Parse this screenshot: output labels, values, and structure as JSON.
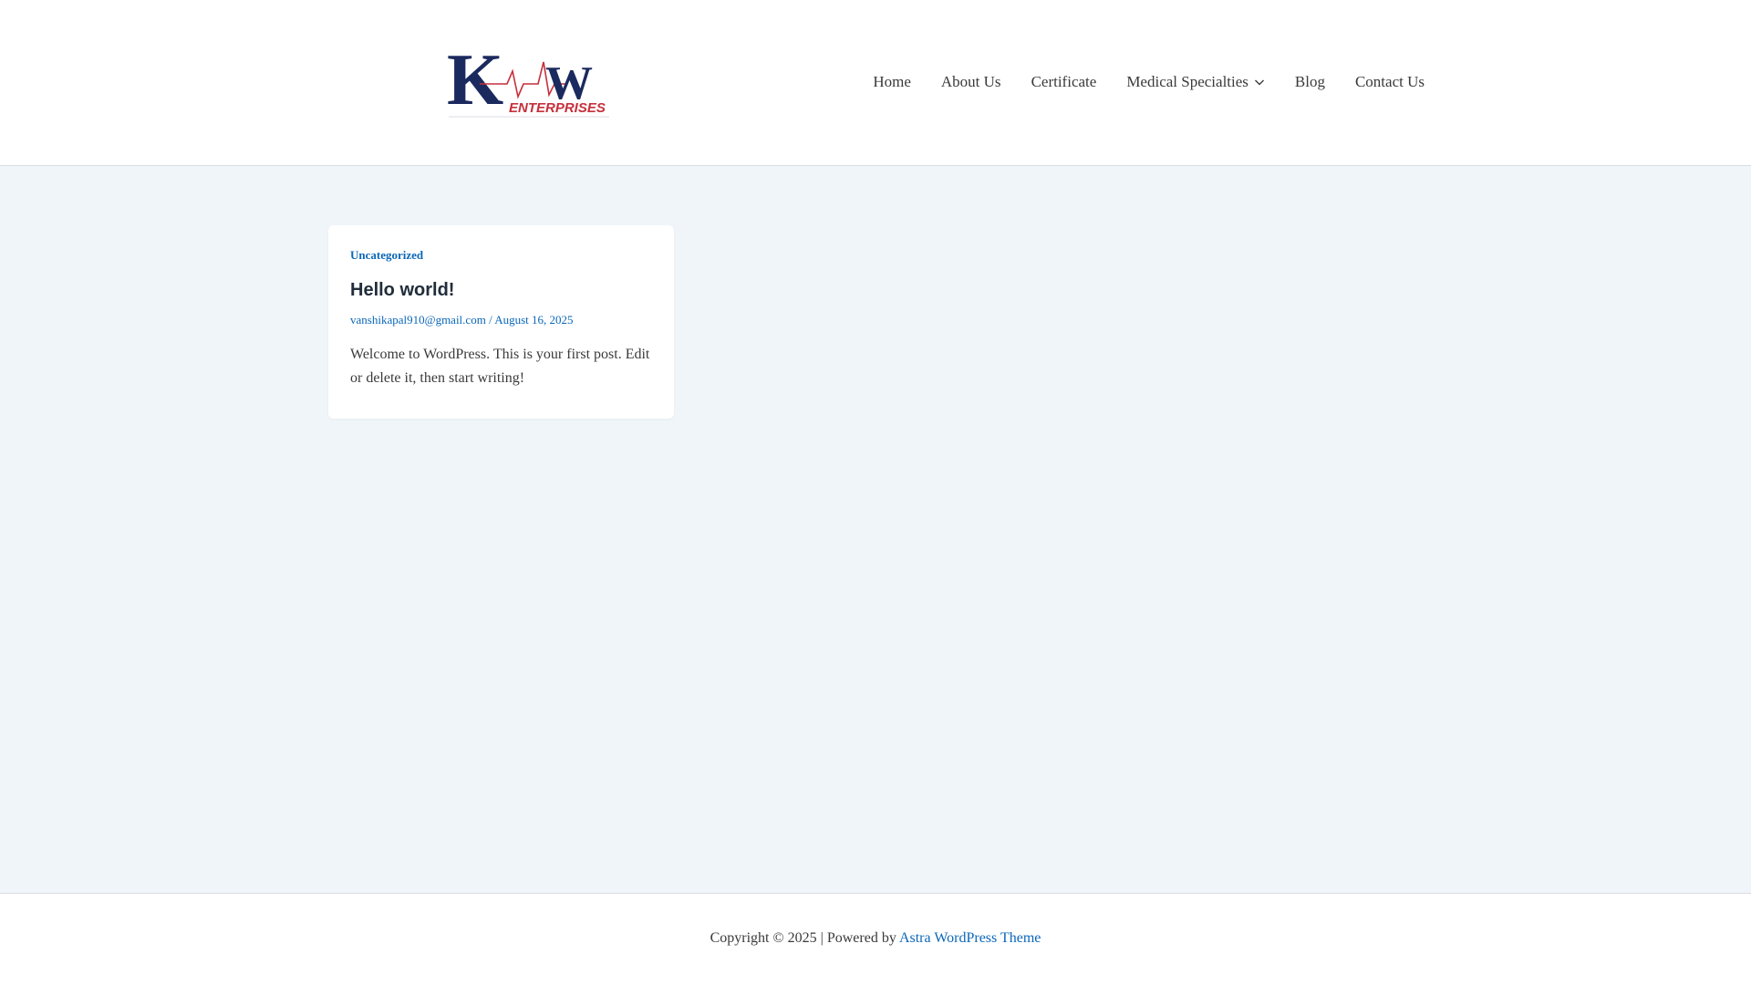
{
  "brand": {
    "logo_letters": "KW",
    "logo_subtitle": "ENTERPRISES",
    "colors": {
      "navy": "#1b2a5e",
      "red": "#c62f3b"
    }
  },
  "nav": {
    "items": [
      {
        "label": "Home"
      },
      {
        "label": "About Us"
      },
      {
        "label": "Certificate"
      },
      {
        "label": "Medical Specialties",
        "has_dropdown": true
      },
      {
        "label": "Blog"
      },
      {
        "label": "Contact Us"
      }
    ]
  },
  "post": {
    "category": "Uncategorized",
    "title": "Hello world!",
    "author": "vanshikapal910@gmail.com",
    "separator": " / ",
    "date": "August 16, 2025",
    "excerpt": "Welcome to WordPress. This is your first post. Edit or delete it, then start writing!"
  },
  "footer": {
    "copyright": "Copyright © 2025 | Powered by ",
    "theme_link": "Astra WordPress Theme"
  },
  "colors": {
    "link": "#0b67b9",
    "page_bg": "#f0f5fa",
    "text": "#3a3a3a"
  }
}
